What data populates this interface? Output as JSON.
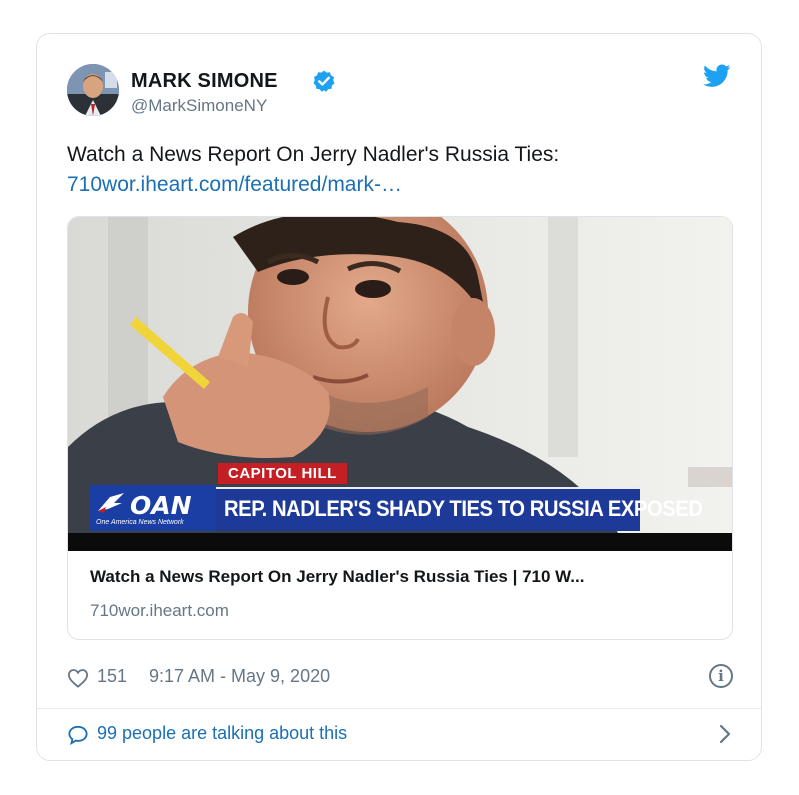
{
  "tweet": {
    "author": {
      "name": "MARK SIMONE",
      "handle": "@MarkSimoneNY",
      "verified": true
    },
    "text": "Watch a News Report On Jerry Nadler's Russia Ties:",
    "link": "710wor.iheart.com/featured/mark-…",
    "card": {
      "image_overlay": {
        "tag": "CAPITOL HILL",
        "network": "OAN",
        "network_tagline": "One America News Network",
        "headline": "REP. NADLER'S SHADY TIES TO RUSSIA EXPOSED"
      },
      "title": "Watch a News Report On Jerry Nadler's Russia Ties | 710 W...",
      "domain": "710wor.iheart.com"
    },
    "likes": "151",
    "timestamp": "9:17 AM - May 9, 2020",
    "talking": "99 people are talking about this"
  },
  "icons": {
    "brand": "twitter-bird-icon",
    "like": "heart-icon",
    "info": "info-icon",
    "reply": "speech-bubble-icon",
    "more": "chevron-right-icon"
  },
  "colors": {
    "link": "#1b6fb3",
    "twitter_blue": "#1da1f2",
    "muted": "#657786",
    "news_red": "#c31f24",
    "news_blue": "#1d3a98"
  }
}
